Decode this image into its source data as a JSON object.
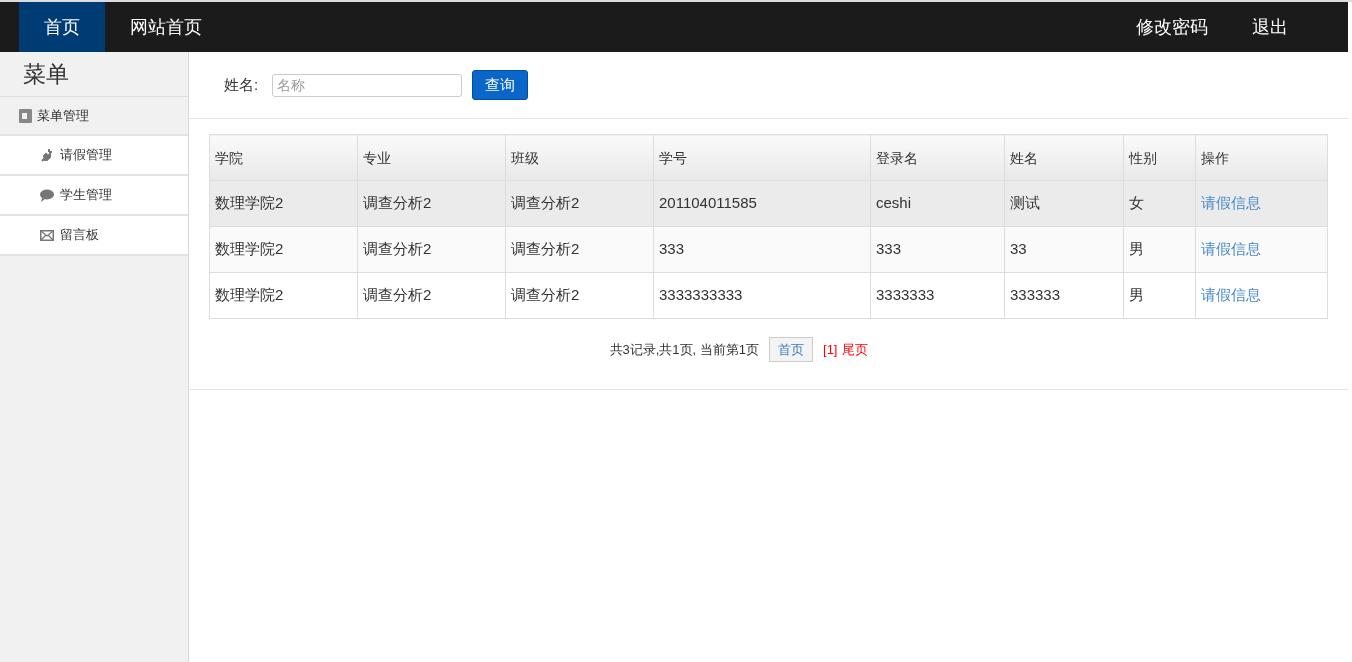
{
  "nav": {
    "left": [
      {
        "label": "首页",
        "selected": true
      },
      {
        "label": "网站首页",
        "selected": false
      }
    ],
    "right": [
      "修改密码",
      "退出"
    ]
  },
  "sidebar": {
    "title": "菜单",
    "group": {
      "label": "菜单管理",
      "children": [
        {
          "label": "请假管理"
        },
        {
          "label": "学生管理"
        },
        {
          "label": "留言板"
        }
      ]
    }
  },
  "search": {
    "label": "姓名:",
    "placeholder": "名称",
    "button": "查询"
  },
  "table": {
    "columns": [
      "学院",
      "专业",
      "班级",
      "学号",
      "登录名",
      "姓名",
      "性别",
      "操作"
    ],
    "rows": [
      {
        "selected": true,
        "cells": [
          "数理学院2",
          "调查分析2",
          "调查分析2",
          "201104011585",
          "ceshi",
          "测试",
          "女"
        ],
        "action": "请假信息"
      },
      {
        "selected": false,
        "cells": [
          "数理学院2",
          "调查分析2",
          "调查分析2",
          "333",
          "333",
          "33",
          "男"
        ],
        "action": "请假信息"
      },
      {
        "selected": false,
        "cells": [
          "数理学院2",
          "调查分析2",
          "调查分析2",
          "3333333333",
          "3333333",
          "333333",
          "男"
        ],
        "action": "请假信息"
      }
    ]
  },
  "pagination": {
    "summary": "共3记录,共1页, 当前第1页",
    "first": "首页",
    "current": "[1]",
    "last": "尾页"
  }
}
